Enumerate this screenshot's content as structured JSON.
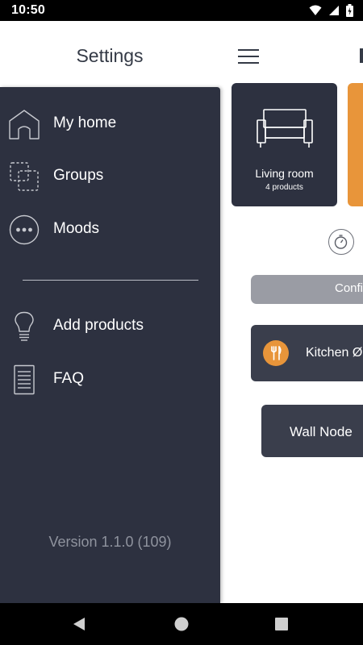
{
  "status_bar": {
    "time": "10:50",
    "icons": [
      "wifi-icon",
      "signal-icon",
      "battery-icon"
    ]
  },
  "header": {
    "title": "Settings",
    "menu_icon": "hamburger-menu-icon"
  },
  "drawer": {
    "items": [
      {
        "label": "My home",
        "icon": "house-icon"
      },
      {
        "label": "Groups",
        "icon": "groups-icon"
      },
      {
        "label": "Moods",
        "icon": "moods-dots-icon"
      },
      {
        "label": "Add products",
        "icon": "lightbulb-icon"
      },
      {
        "label": "FAQ",
        "icon": "document-icon"
      }
    ],
    "version": "Version 1.1.0 (109)"
  },
  "content": {
    "room_card": {
      "name": "Living room",
      "count": "4 products",
      "icon": "sofa-icon"
    },
    "timer_icon": "timer-icon",
    "confirm_label": "Confi",
    "kitchen": {
      "label": "Kitchen Ø",
      "icon": "cutlery-icon"
    },
    "wall_node": {
      "label": "Wall Node"
    }
  },
  "nav_bar": {
    "buttons": [
      "back-icon",
      "home-icon",
      "recents-icon"
    ]
  },
  "colors": {
    "drawer_bg": "#2d3140",
    "accent": "#e8953a",
    "card_bg": "#3a3e4c",
    "text_dark": "#343a46"
  }
}
